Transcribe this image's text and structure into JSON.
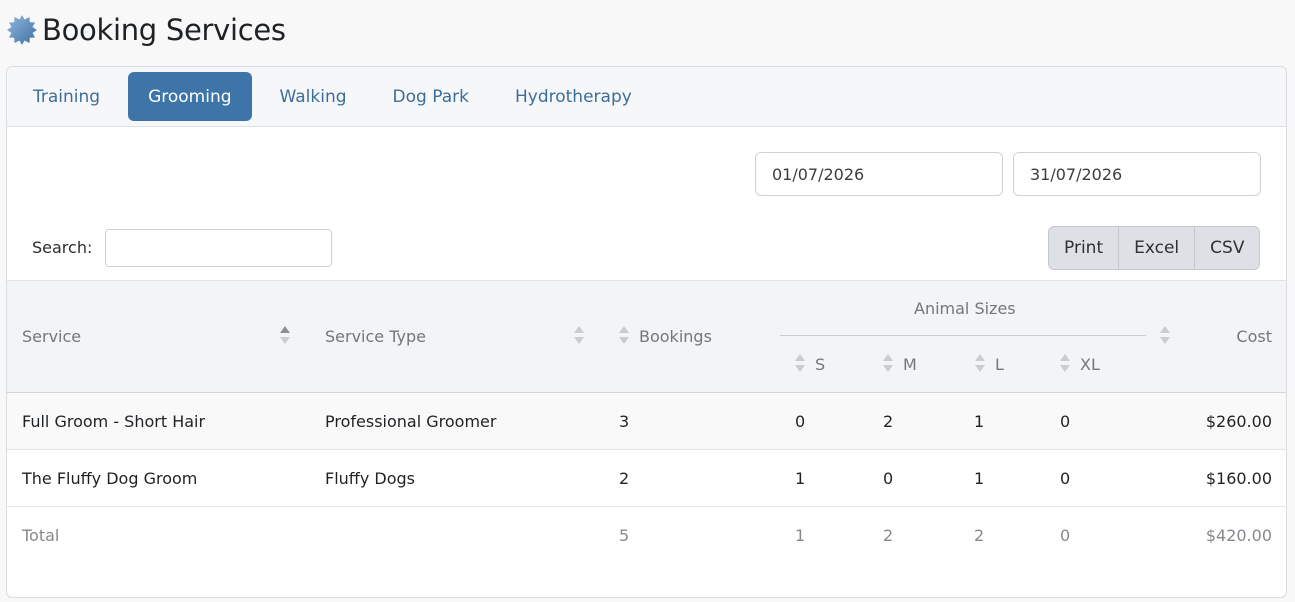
{
  "header": {
    "title": "Booking Services",
    "icon": "gear-icon"
  },
  "tabs": [
    {
      "label": "Training",
      "active": false
    },
    {
      "label": "Grooming",
      "active": true
    },
    {
      "label": "Walking",
      "active": false
    },
    {
      "label": "Dog Park",
      "active": false
    },
    {
      "label": "Hydrotherapy",
      "active": false
    }
  ],
  "date_range": {
    "from": "01/07/2026",
    "to": "31/07/2026"
  },
  "search": {
    "label": "Search:",
    "value": ""
  },
  "export_buttons": {
    "print": "Print",
    "excel": "Excel",
    "csv": "CSV"
  },
  "table": {
    "columns": {
      "service": "Service",
      "service_type": "Service Type",
      "bookings": "Bookings",
      "animal_sizes": "Animal Sizes",
      "s": "S",
      "m": "M",
      "l": "L",
      "xl": "XL",
      "cost": "Cost"
    },
    "rows": [
      {
        "service": "Full Groom - Short Hair",
        "service_type": "Professional Groomer",
        "bookings": "3",
        "s": "0",
        "m": "2",
        "l": "1",
        "xl": "0",
        "cost": "$260.00"
      },
      {
        "service": "The Fluffy Dog Groom",
        "service_type": "Fluffy Dogs",
        "bookings": "2",
        "s": "1",
        "m": "0",
        "l": "1",
        "xl": "0",
        "cost": "$160.00"
      }
    ],
    "total": {
      "label": "Total",
      "bookings": "5",
      "s": "1",
      "m": "2",
      "l": "2",
      "xl": "0",
      "cost": "$420.00"
    }
  },
  "colors": {
    "accent": "#3d75a8",
    "tab_text": "#3c6e9c",
    "button_bg": "#dde0e4"
  }
}
